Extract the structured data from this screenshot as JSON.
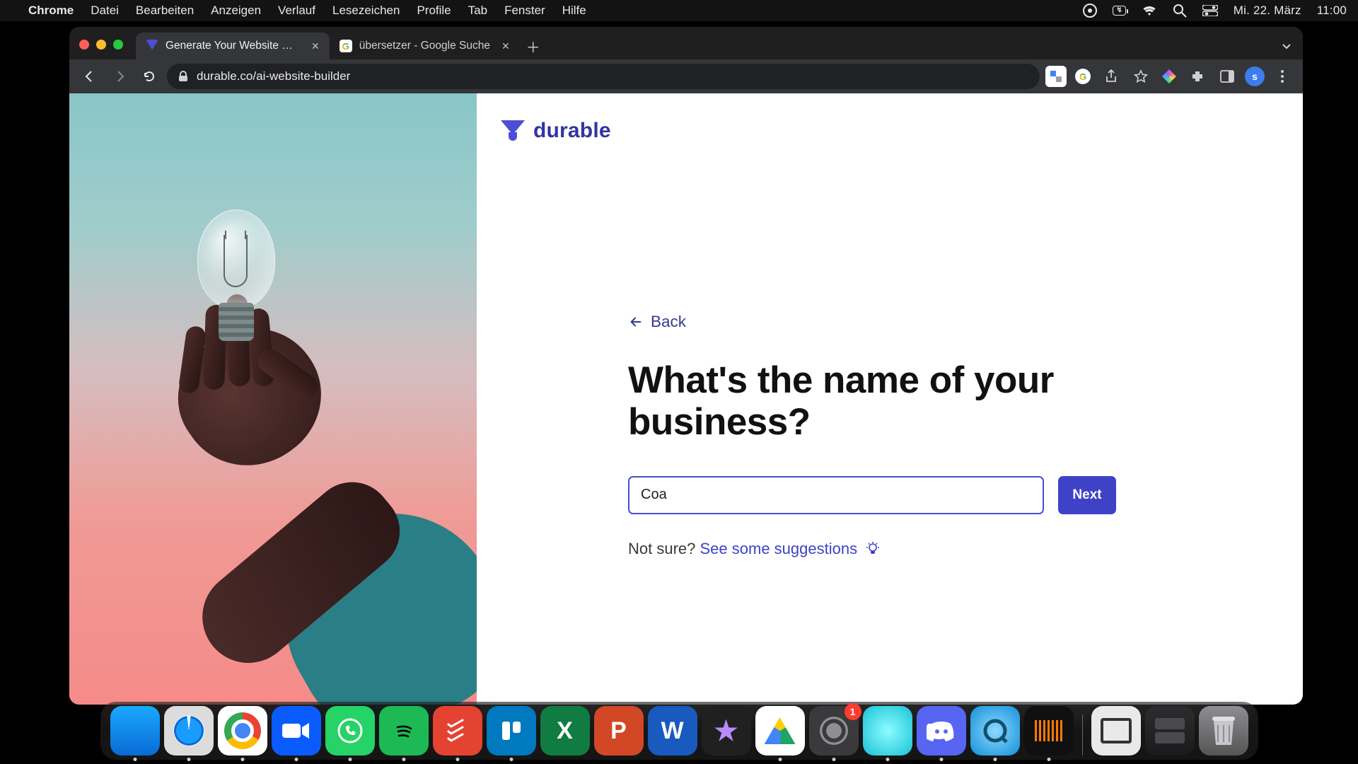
{
  "mac_menu": {
    "app_name": "Chrome",
    "items": [
      "Datei",
      "Bearbeiten",
      "Anzeigen",
      "Verlauf",
      "Lesezeichen",
      "Profile",
      "Tab",
      "Fenster",
      "Hilfe"
    ],
    "battery_text": "↯",
    "date": "Mi. 22. März",
    "time": "11:00"
  },
  "browser": {
    "tabs": [
      {
        "title": "Generate Your Website with AI",
        "active": true
      },
      {
        "title": "übersetzer - Google Suche",
        "active": false
      }
    ],
    "url": "durable.co/ai-website-builder",
    "avatar_initial": "s"
  },
  "page": {
    "brand": "durable",
    "back_label": "Back",
    "heading": "What's the name of your business?",
    "input_value": "Coa",
    "next_label": "Next",
    "suggest_prefix": "Not sure? ",
    "suggest_link": "See some suggestions"
  },
  "dock": {
    "settings_badge": "1",
    "apps": [
      {
        "name": "finder",
        "running": true
      },
      {
        "name": "safari",
        "running": true
      },
      {
        "name": "chrome",
        "running": true
      },
      {
        "name": "zoom",
        "running": true
      },
      {
        "name": "whatsapp",
        "running": true
      },
      {
        "name": "spotify",
        "running": true
      },
      {
        "name": "todoist",
        "running": true
      },
      {
        "name": "trello",
        "running": true
      },
      {
        "name": "excel",
        "running": false
      },
      {
        "name": "powerpoint",
        "running": false
      },
      {
        "name": "word",
        "running": false
      },
      {
        "name": "imovie",
        "running": false
      },
      {
        "name": "google-drive",
        "running": true
      },
      {
        "name": "settings",
        "running": true
      },
      {
        "name": "teal-app",
        "running": true
      },
      {
        "name": "discord",
        "running": true
      },
      {
        "name": "quicktime",
        "running": true
      },
      {
        "name": "audio-app",
        "running": true
      },
      {
        "name": "capture-app",
        "running": false
      },
      {
        "name": "folder",
        "running": false
      },
      {
        "name": "trash",
        "running": false
      }
    ]
  }
}
